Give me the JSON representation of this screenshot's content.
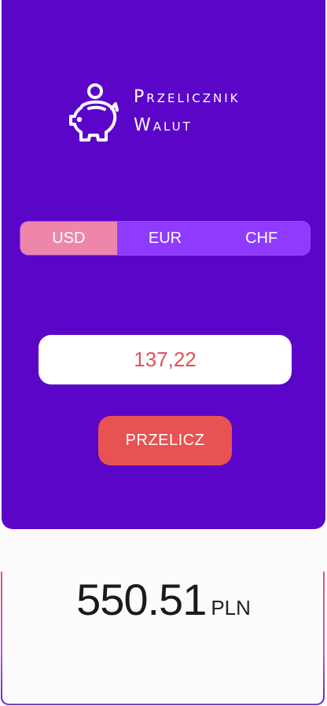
{
  "app": {
    "title_line1": "Przelicznik",
    "title_line2": "Walut",
    "logo_icon": "piggy-bank-icon"
  },
  "currencies": {
    "options": [
      "USD",
      "EUR",
      "CHF"
    ],
    "selected": "USD"
  },
  "amount_input": {
    "value": "137,22"
  },
  "convert_button": {
    "label": "PRZELICZ"
  },
  "result": {
    "value": "550.51",
    "unit": "PLN"
  },
  "colors": {
    "header_bg": "#5b05c8",
    "segment_bg": "#8f3aff",
    "segment_active": "#ee86aa",
    "button_bg": "#e85252",
    "input_text": "#e0525a"
  }
}
